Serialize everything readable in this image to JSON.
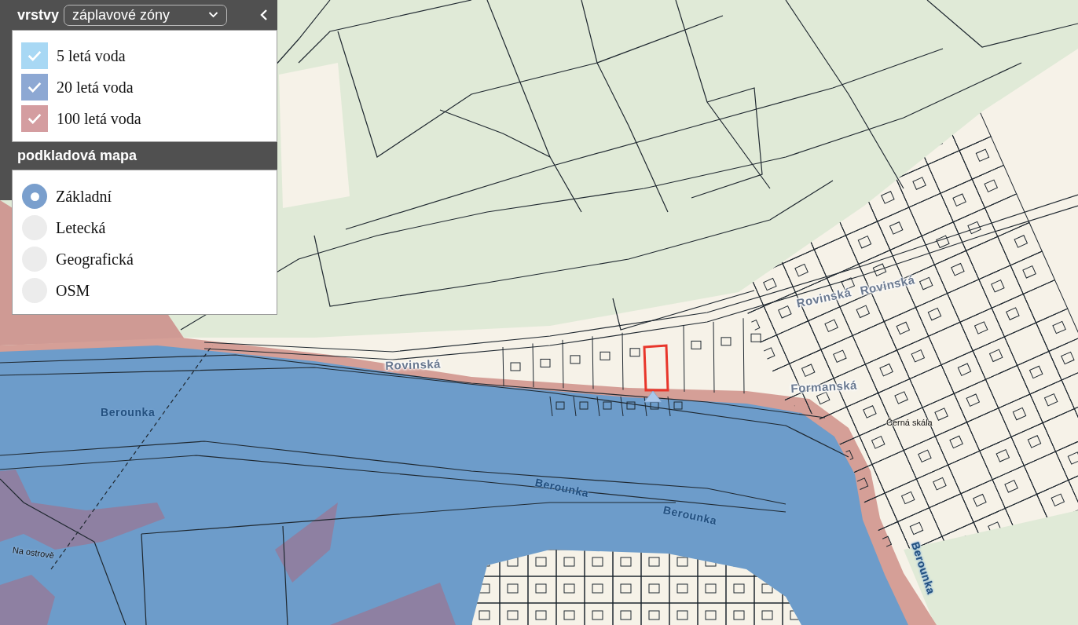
{
  "layers_panel": {
    "title": "vrstvy",
    "layer_select": {
      "value": "záplavové zóny"
    },
    "legend": [
      {
        "label": "5 letá voda",
        "color": "#a8d8f4",
        "checked": true
      },
      {
        "label": "20 letá voda",
        "color": "#8da8d3",
        "checked": true
      },
      {
        "label": "100 letá voda",
        "color": "#d49da0",
        "checked": true
      }
    ],
    "basemap_title": "podkladová mapa",
    "basemaps": [
      {
        "label": "Základní",
        "selected": true
      },
      {
        "label": "Letecká",
        "selected": false
      },
      {
        "label": "Geografická",
        "selected": false
      },
      {
        "label": "OSM",
        "selected": false
      }
    ]
  },
  "map": {
    "labels": [
      {
        "kind": "street",
        "text": "Rovinská"
      },
      {
        "kind": "street",
        "text": "Rovinská"
      },
      {
        "kind": "street",
        "text": "Rovinská"
      },
      {
        "kind": "street",
        "text": "Formanská"
      },
      {
        "kind": "river",
        "text": "Berounka"
      },
      {
        "kind": "river",
        "text": "Berounka"
      },
      {
        "kind": "river",
        "text": "Berounka"
      },
      {
        "kind": "river",
        "text": "Berounka"
      },
      {
        "kind": "place",
        "text": "Černá skála"
      },
      {
        "kind": "place",
        "text": "Na ostrově"
      }
    ]
  }
}
